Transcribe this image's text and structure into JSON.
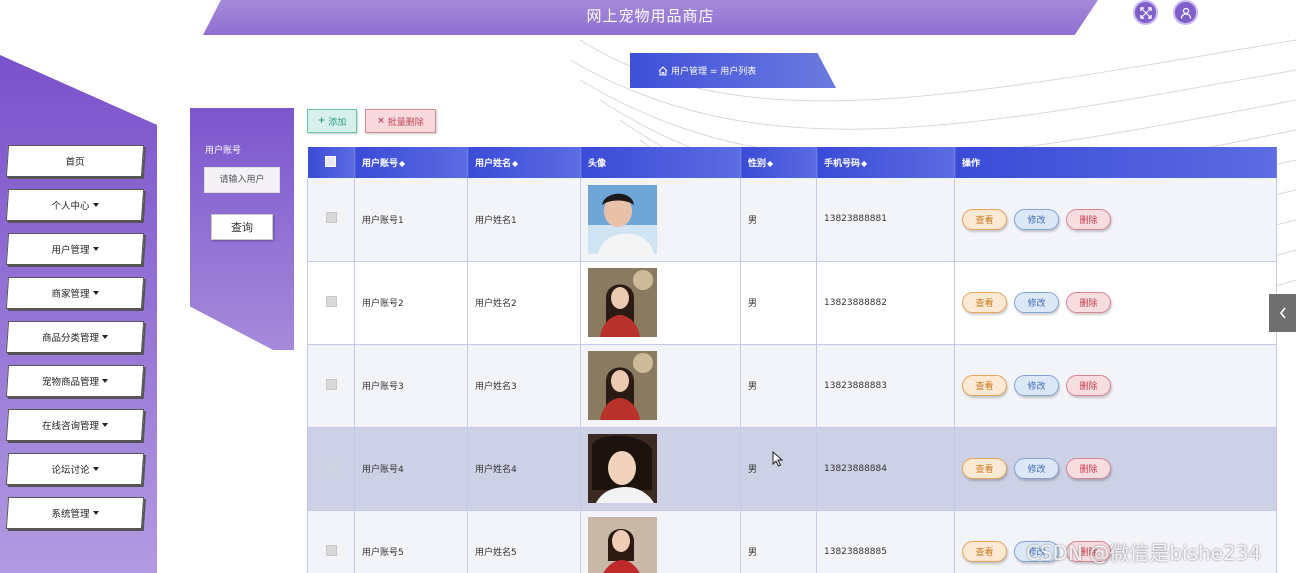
{
  "header": {
    "title": "网上宠物用品商店"
  },
  "breadcrumb": {
    "text": "用户管理 = 用户列表"
  },
  "sidebar": {
    "items": [
      {
        "label": "首页",
        "has_caret": false
      },
      {
        "label": "个人中心",
        "has_caret": true
      },
      {
        "label": "用户管理",
        "has_caret": true
      },
      {
        "label": "商家管理",
        "has_caret": true
      },
      {
        "label": "商品分类管理",
        "has_caret": true
      },
      {
        "label": "宠物商品管理",
        "has_caret": true
      },
      {
        "label": "在线咨询管理",
        "has_caret": true
      },
      {
        "label": "论坛讨论",
        "has_caret": true
      },
      {
        "label": "系统管理",
        "has_caret": true
      }
    ]
  },
  "search": {
    "label": "用户账号",
    "placeholder": "请输入用户",
    "button": "查询"
  },
  "toolbar": {
    "add": "添加",
    "batch_delete": "批量删除"
  },
  "table": {
    "headers": {
      "account": "用户账号",
      "name": "用户姓名",
      "avatar": "头像",
      "gender": "性别",
      "phone": "手机号码",
      "ops": "操作"
    },
    "sort_glyph": "◆",
    "rows": [
      {
        "account": "用户账号1",
        "name": "用户姓名1",
        "gender": "男",
        "phone": "13823888881"
      },
      {
        "account": "用户账号2",
        "name": "用户姓名2",
        "gender": "男",
        "phone": "13823888882"
      },
      {
        "account": "用户账号3",
        "name": "用户姓名3",
        "gender": "男",
        "phone": "13823888883"
      },
      {
        "account": "用户账号4",
        "name": "用户姓名4",
        "gender": "男",
        "phone": "13823888884"
      },
      {
        "account": "用户账号5",
        "name": "用户姓名5",
        "gender": "男",
        "phone": "13823888885"
      }
    ],
    "actions": {
      "view": "查看",
      "edit": "修改",
      "delete": "删除"
    }
  },
  "watermark": "CSDN @微信是bishe234",
  "colors": {
    "primary": "#3a4bd7",
    "sidebar": "#7a52cb",
    "header": "#9a7bd5"
  }
}
